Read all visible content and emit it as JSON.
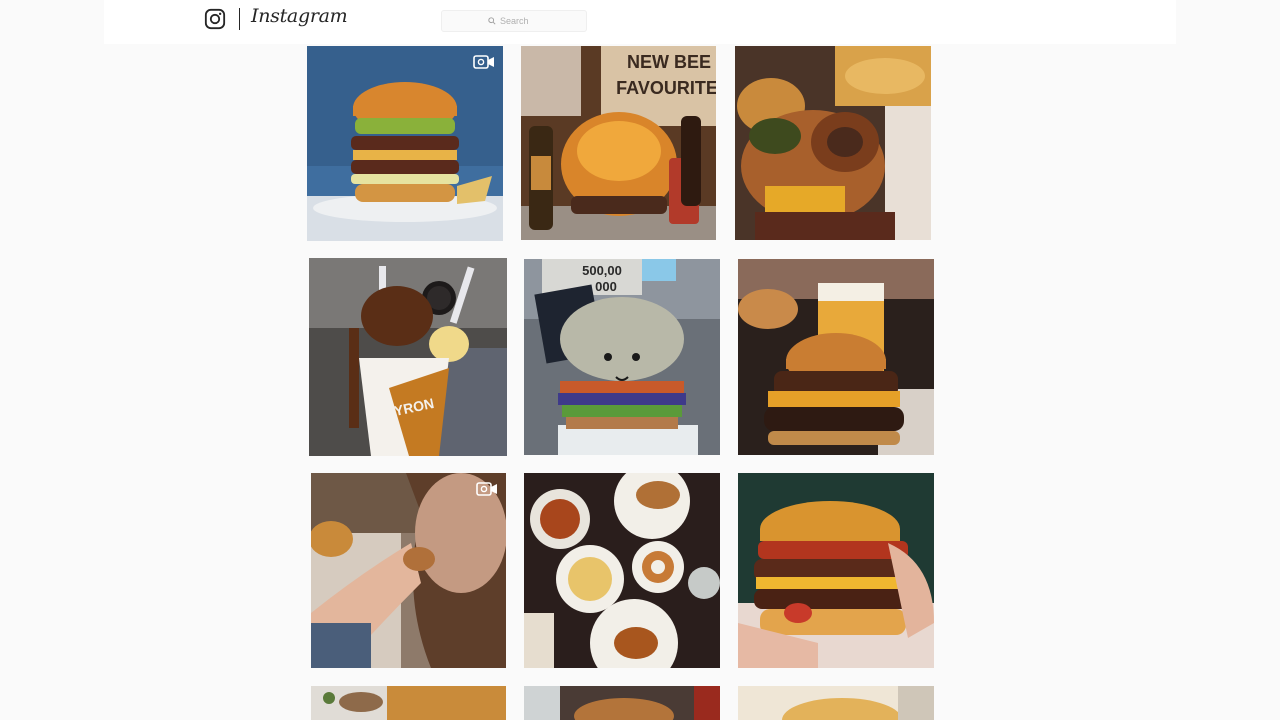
{
  "app": {
    "name": "Instagram",
    "logo_icon": "instagram-camera-icon"
  },
  "search": {
    "placeholder": "Search",
    "icon": "search-icon"
  },
  "grid": {
    "posts": [
      {
        "subject": "double-cheeseburger",
        "media": "video",
        "palette": [
          "#3f6e9f",
          "#c9782e"
        ]
      },
      {
        "subject": "burger-with-beer-bottles",
        "media": "photo",
        "palette": [
          "#6e4a2c",
          "#e0932e"
        ]
      },
      {
        "subject": "onion-ring-burger",
        "media": "photo",
        "palette": [
          "#7a4d2a",
          "#d6a155"
        ]
      },
      {
        "subject": "oreo-milkshake",
        "media": "photo",
        "palette": [
          "#4a4a4a",
          "#c17a2c"
        ]
      },
      {
        "subject": "crochet-burger-toy",
        "media": "photo",
        "palette": [
          "#5c6470",
          "#a8a89a"
        ]
      },
      {
        "subject": "cheeseburger-and-beer",
        "media": "photo",
        "palette": [
          "#3a2a24",
          "#d9942f"
        ]
      },
      {
        "subject": "person-eating-burger",
        "media": "video",
        "palette": [
          "#6a5646",
          "#c4a189"
        ]
      },
      {
        "subject": "table-of-dishes",
        "media": "photo",
        "palette": [
          "#2a1e1c",
          "#e8d9c1"
        ]
      },
      {
        "subject": "bacon-cheeseburger-in-hand",
        "media": "photo",
        "palette": [
          "#1f3a33",
          "#d98a30"
        ]
      },
      {
        "subject": "partial-row-1",
        "media": "photo",
        "palette": [
          "#e0dcd6",
          "#c98b3a"
        ]
      },
      {
        "subject": "partial-row-2",
        "media": "photo",
        "palette": [
          "#4a3b35",
          "#b3743a"
        ]
      },
      {
        "subject": "partial-row-3",
        "media": "photo",
        "palette": [
          "#efe6d6",
          "#e3b25a"
        ]
      }
    ]
  },
  "colors": {
    "page_background": "#fafafa",
    "header_background": "#ffffff",
    "text": "#262626"
  }
}
